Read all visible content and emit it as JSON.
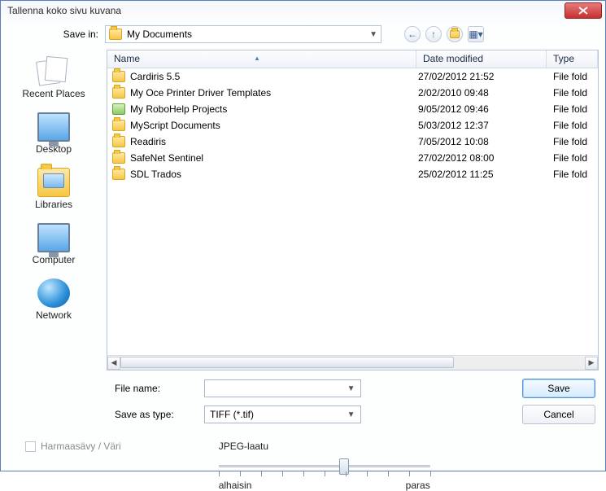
{
  "window": {
    "title": "Tallenna koko sivu kuvana"
  },
  "toprow": {
    "save_in_label": "Save in:",
    "location": "My Documents"
  },
  "columns": {
    "name": "Name",
    "date": "Date modified",
    "type": "Type"
  },
  "files": [
    {
      "name": "Cardiris 5.5",
      "date": "27/02/2012 21:52",
      "type": "File fold",
      "icon": "folder"
    },
    {
      "name": "My Oce Printer Driver Templates",
      "date": "2/02/2010 09:48",
      "type": "File fold",
      "icon": "folder"
    },
    {
      "name": "My RoboHelp Projects",
      "date": "9/05/2012 09:46",
      "type": "File fold",
      "icon": "robohelp"
    },
    {
      "name": "MyScript Documents",
      "date": "5/03/2012 12:37",
      "type": "File fold",
      "icon": "folder"
    },
    {
      "name": "Readiris",
      "date": "7/05/2012 10:08",
      "type": "File fold",
      "icon": "folder"
    },
    {
      "name": "SafeNet Sentinel",
      "date": "27/02/2012 08:00",
      "type": "File fold",
      "icon": "folder"
    },
    {
      "name": "SDL Trados",
      "date": "25/02/2012 11:25",
      "type": "File fold",
      "icon": "folder"
    }
  ],
  "places": {
    "recent": "Recent Places",
    "desktop": "Desktop",
    "libraries": "Libraries",
    "computer": "Computer",
    "network": "Network"
  },
  "bottom": {
    "file_name_label": "File name:",
    "file_name_value": "",
    "save_as_type_label": "Save as type:",
    "save_as_type_value": "TIFF (*.tif)",
    "save_btn": "Save",
    "cancel_btn": "Cancel"
  },
  "footer": {
    "grayscale_label": "Harmaasävy / Väri",
    "jpeg_quality_label": "JPEG-laatu",
    "lowest": "alhaisin",
    "best": "paras"
  }
}
